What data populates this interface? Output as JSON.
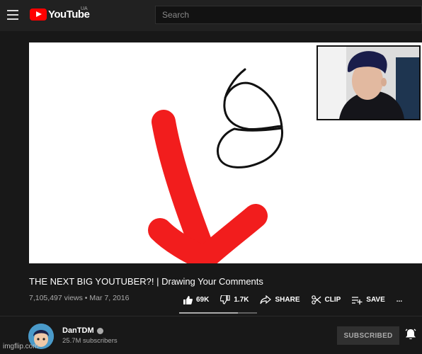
{
  "header": {
    "logo_text": "YouTube",
    "country_code": "UA",
    "search_placeholder": "Search"
  },
  "video": {
    "title": "THE NEXT BIG YOUTUBER?! | Drawing Your Comments",
    "views": "7,105,497 views",
    "date": "Mar 7, 2016"
  },
  "actions": {
    "likes": "69K",
    "dislikes": "1.7K",
    "share": "SHARE",
    "clip": "CLIP",
    "save": "SAVE",
    "more": "...",
    "like_ratio": 0.75
  },
  "channel": {
    "name": "DanTDM",
    "subscribers": "25.7M subscribers",
    "subscribe_label": "SUBSCRIBED"
  },
  "watermark": "imgflip.com"
}
